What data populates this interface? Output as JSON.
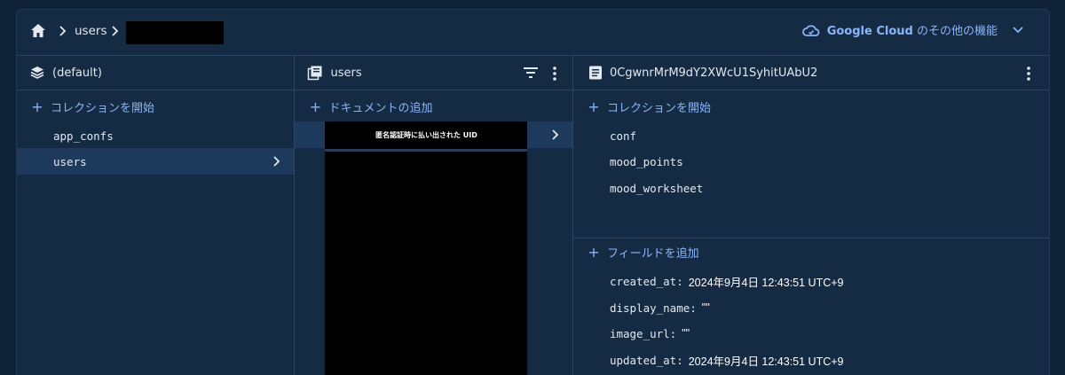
{
  "breadcrumb": {
    "items": [
      "users"
    ]
  },
  "header": {
    "gcloud_brand": "Google Cloud",
    "gcloud_text": "のその他の機能"
  },
  "panel_root": {
    "title": "(default)",
    "add_label": "コレクションを開始",
    "items": [
      {
        "label": "app_confs"
      },
      {
        "label": "users"
      }
    ]
  },
  "panel_collection": {
    "title": "users",
    "add_label": "ドキュメントの追加",
    "redacted_doc_label": "匿名認証時に払い出された UID"
  },
  "panel_document": {
    "title": "0CgwnrMrM9dY2XWcU1SyhitUAbU2",
    "add_collection_label": "コレクションを開始",
    "subcollections": [
      {
        "label": "conf"
      },
      {
        "label": "mood_points"
      },
      {
        "label": "mood_worksheet"
      }
    ],
    "add_field_label": "フィールドを追加",
    "fields": [
      {
        "key": "created_at:",
        "value": "2024年9月4日 12:43:51 UTC+9"
      },
      {
        "key": "display_name:",
        "value": "\"\""
      },
      {
        "key": "image_url:",
        "value": "\"\""
      },
      {
        "key": "updated_at:",
        "value": "2024年9月4日 12:43:51 UTC+9"
      }
    ]
  },
  "colors": {
    "background": "#0f2237",
    "panel": "#152b44",
    "selected": "#1d3a5c",
    "accent": "#8ab4f8",
    "border": "#2b4562"
  }
}
